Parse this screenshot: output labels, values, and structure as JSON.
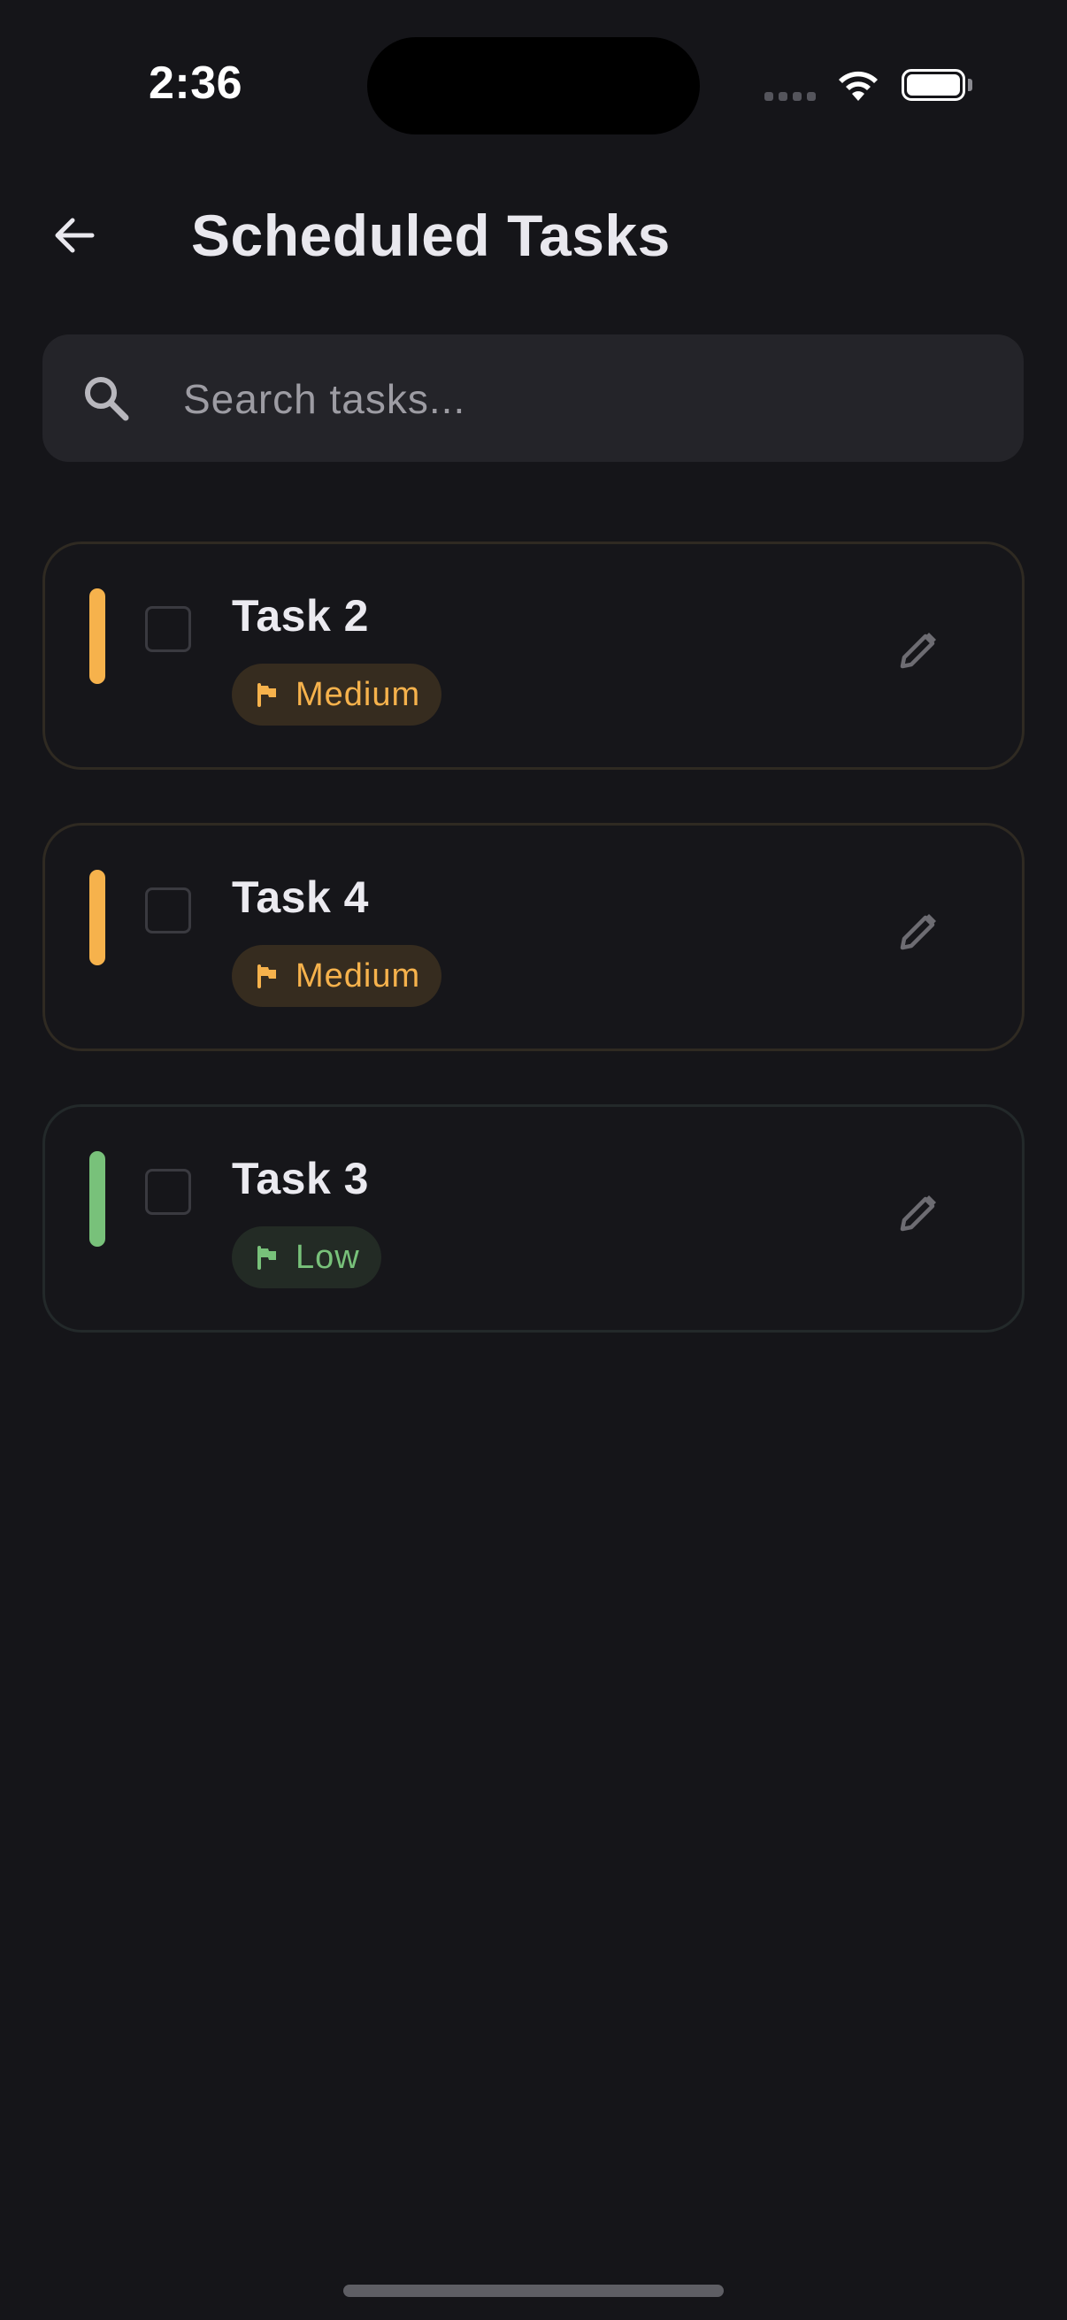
{
  "status_bar": {
    "time": "2:36",
    "icons": [
      "cellular-signal-icon",
      "wifi-icon",
      "battery-icon"
    ]
  },
  "header": {
    "back_icon": "arrow-left-icon",
    "title": "Scheduled Tasks"
  },
  "search": {
    "icon": "search-icon",
    "placeholder": "Search tasks...",
    "value": ""
  },
  "tasks": [
    {
      "title": "Task 2",
      "priority": "Medium",
      "priority_color": "#f6b24c",
      "completed": false,
      "edit_icon": "pencil-icon"
    },
    {
      "title": "Task 4",
      "priority": "Medium",
      "priority_color": "#f6b24c",
      "completed": false,
      "edit_icon": "pencil-icon"
    },
    {
      "title": "Task 3",
      "priority": "Low",
      "priority_color": "#78c17a",
      "completed": false,
      "edit_icon": "pencil-icon"
    }
  ],
  "colors": {
    "background": "#151519",
    "surface": "#242429",
    "medium": "#f6b24c",
    "low": "#78c17a",
    "text": "#e9e8ee"
  }
}
